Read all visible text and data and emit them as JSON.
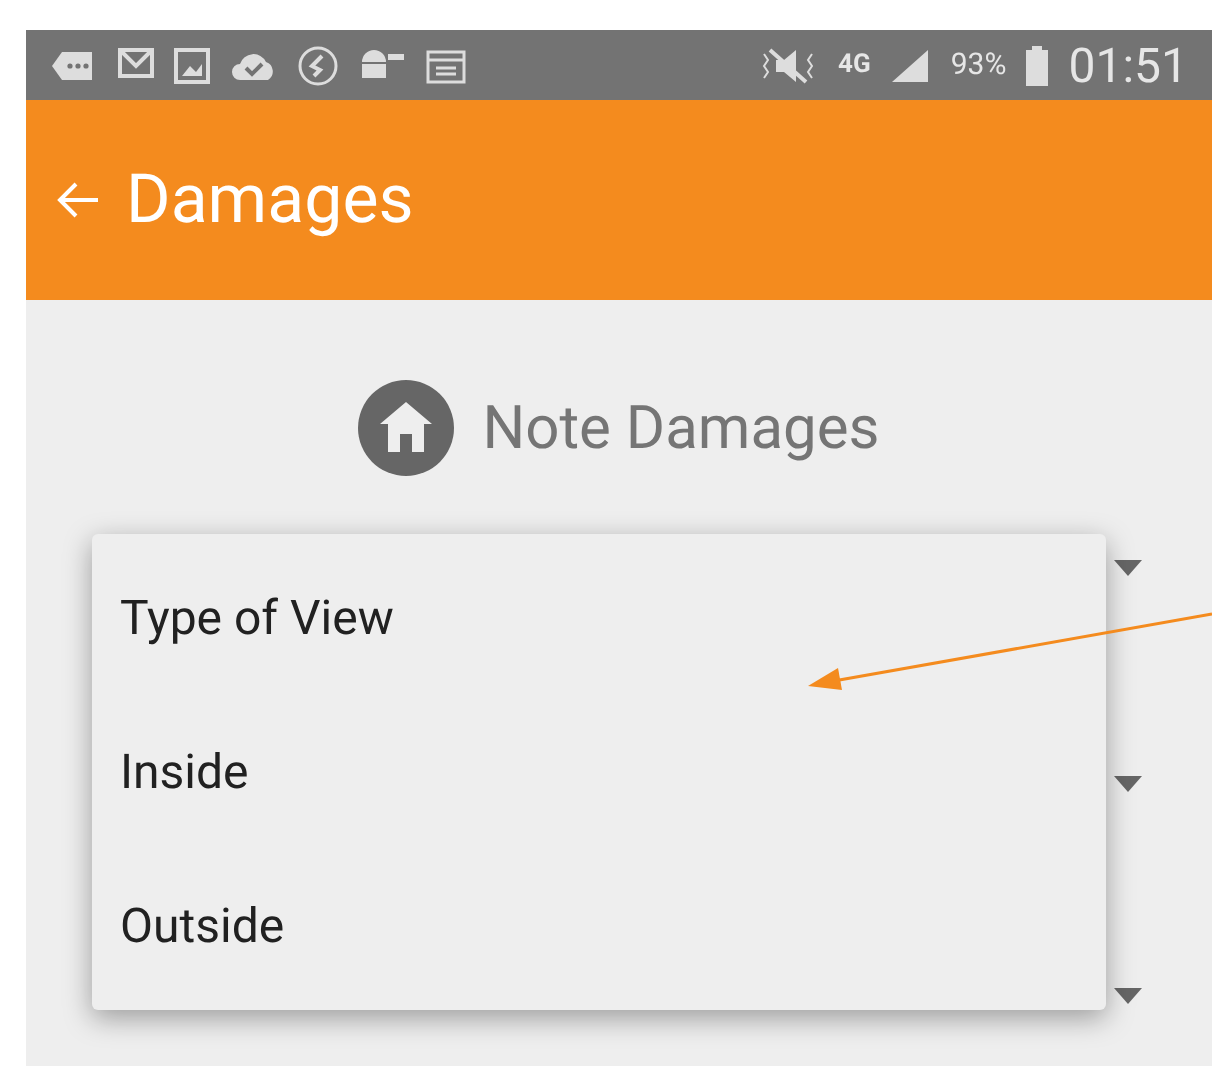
{
  "status_bar": {
    "network": "4G",
    "battery": "93%",
    "time": "01:51"
  },
  "app_bar": {
    "title": "Damages"
  },
  "section": {
    "title": "Note Damages"
  },
  "menu": {
    "items": [
      {
        "label": "Type of View"
      },
      {
        "label": "Inside"
      },
      {
        "label": "Outside"
      }
    ]
  }
}
